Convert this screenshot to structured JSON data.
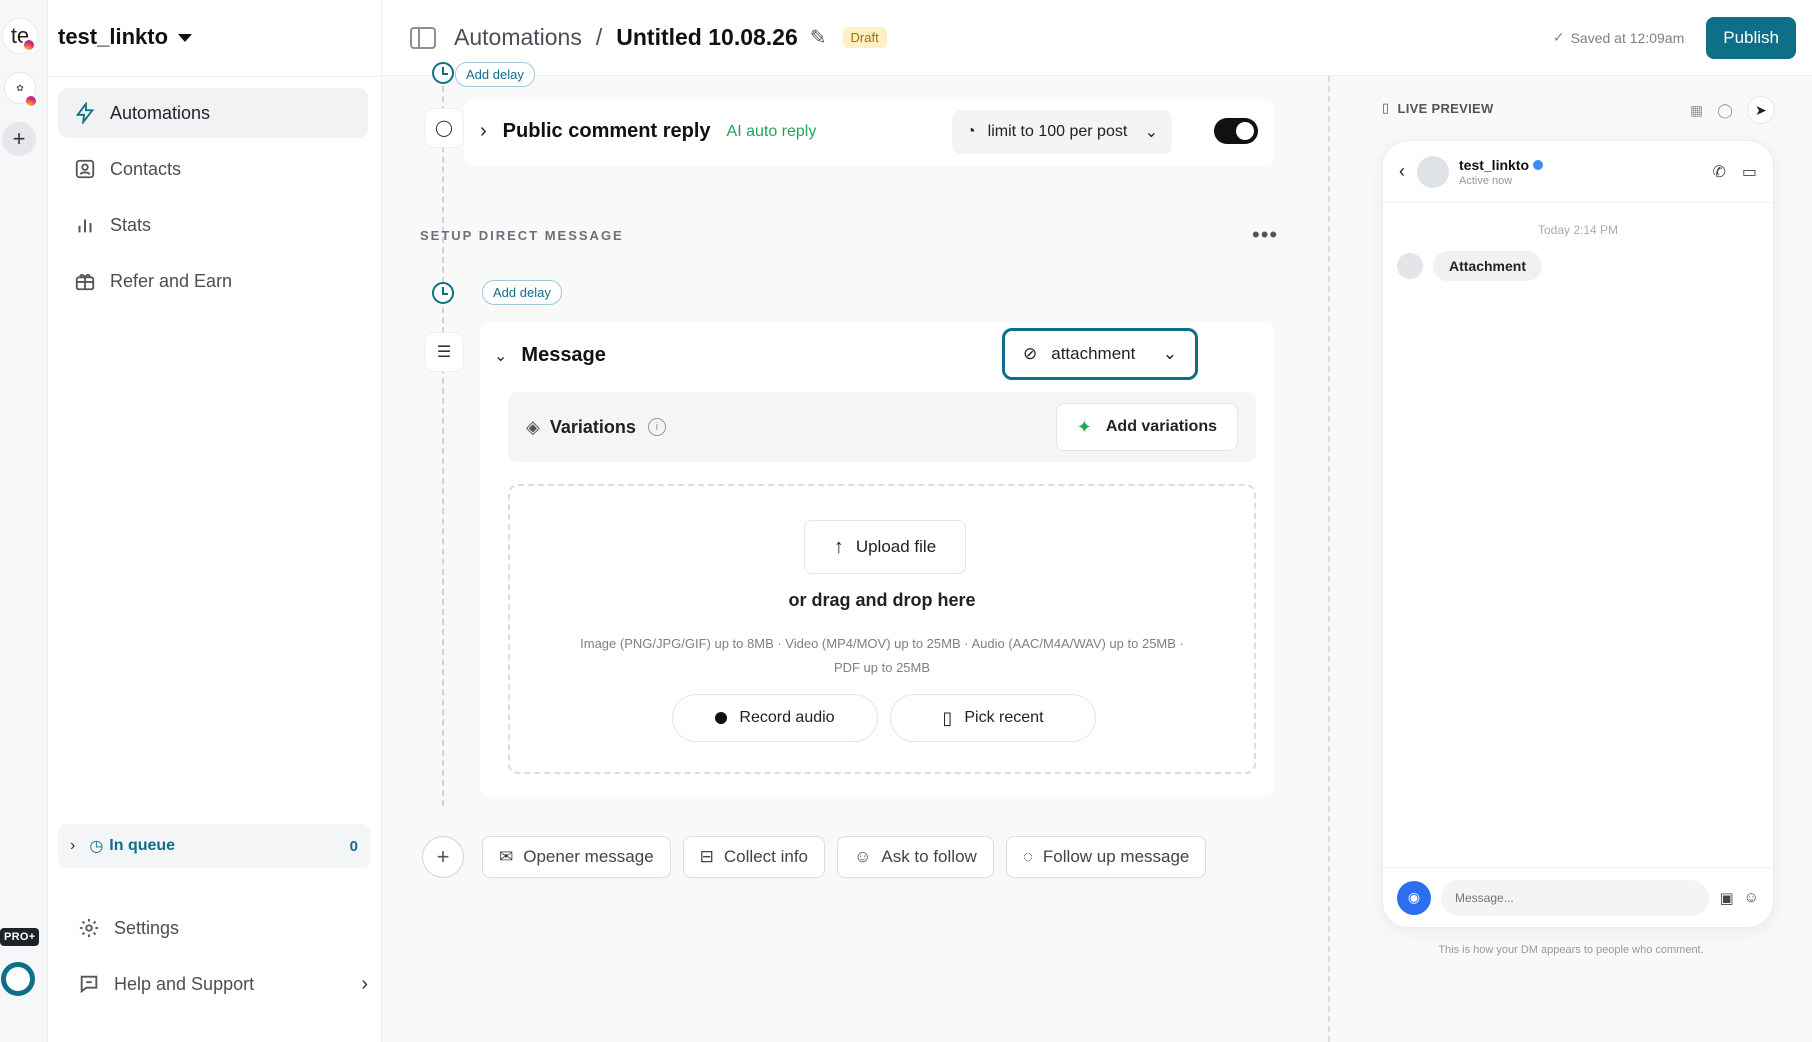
{
  "workspace": {
    "avatar_letters": "te",
    "name": "test_linkto"
  },
  "rail": {
    "pro_badge": "PRO+"
  },
  "sidebar": {
    "nav": [
      {
        "label": "Automations",
        "icon": "bolt-icon",
        "active": true
      },
      {
        "label": "Contacts",
        "icon": "contact-icon",
        "active": false
      },
      {
        "label": "Stats",
        "icon": "bar-chart-icon",
        "active": false
      },
      {
        "label": "Refer and Earn",
        "icon": "gift-icon",
        "active": false
      }
    ],
    "queue": {
      "label": "In queue",
      "count": "0"
    },
    "settings_label": "Settings",
    "help_label": "Help and Support"
  },
  "header": {
    "crumb_root": "Automations",
    "crumb_sep": "/",
    "crumb_current": "Untitled 10.08.26",
    "status_badge": "Draft",
    "saved_text": "Saved at 12:09am",
    "publish_label": "Publish"
  },
  "canvas": {
    "top_delay_label": "Add delay",
    "comment_reply": {
      "title": "Public comment reply",
      "subtitle": "AI auto reply",
      "limit_label": "limit to 100 per post",
      "enabled": true
    },
    "section_title": "SETUP DIRECT MESSAGE",
    "section_menu": "•••",
    "dm_delay_label": "Add delay",
    "message": {
      "title": "Message",
      "type_label": "attachment",
      "variations_title": "Variations",
      "add_variations_label": "Add variations",
      "upload_label": "Upload file",
      "drag_text": "or drag and drop here",
      "limits_line1": "Image (PNG/JPG/GIF) up to 8MB · Video (MP4/MOV) up to 25MB · Audio (AAC/M4A/WAV) up to 25MB ·",
      "limits_line2": "PDF up to 25MB",
      "record_label": "Record audio",
      "pick_label": "Pick recent"
    },
    "quick_actions": [
      {
        "label": "Opener message",
        "icon": "mail-icon"
      },
      {
        "label": "Collect info",
        "icon": "inbox-icon"
      },
      {
        "label": "Ask to follow",
        "icon": "user-check-icon"
      },
      {
        "label": "Follow up message",
        "icon": "chat-bubble-icon"
      }
    ]
  },
  "preview": {
    "header": "LIVE PREVIEW",
    "contact_name": "test_linkto",
    "contact_status": "Active now",
    "timestamp": "Today 2:14 PM",
    "bubble_text": "Attachment",
    "input_placeholder": "Message...",
    "caption": "This is how your DM appears to people who comment."
  },
  "colors": {
    "accent": "#0e6f89",
    "ai_green": "#21a35a",
    "draft_bg": "#fdf0c4",
    "messenger_blue": "#2d6ef1"
  }
}
